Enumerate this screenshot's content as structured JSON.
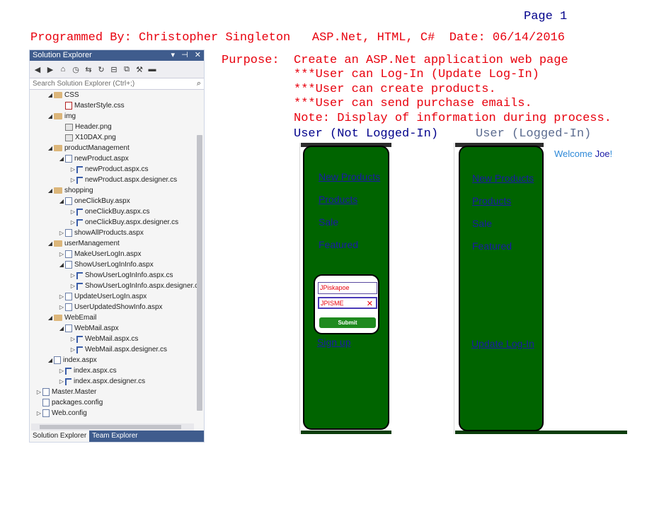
{
  "header": {
    "page_label": "Page 1",
    "programmed_line": "Programmed By: Christopher Singleton   ASP.Net, HTML, C#  Date: 06/14/2016"
  },
  "purpose": {
    "label": "Purpose:",
    "lines": [
      "Create an ASP.Net application web page",
      "***User can Log-In (Update Log-In)",
      "***User can create products.",
      "***User can send purchase emails.",
      "Note: Display of information during process."
    ],
    "user_not_logged": "User (Not Logged-In)",
    "user_logged": "User (Logged-In)"
  },
  "solution_explorer": {
    "title": "Solution Explorer",
    "title_buttons": [
      "▾",
      "⊣",
      "✕"
    ],
    "search_placeholder": "Search Solution Explorer (Ctrl+;)",
    "tree": [
      {
        "label": "CSS",
        "indent": 0,
        "arrow": "◢",
        "icon": "folder"
      },
      {
        "label": "MasterStyle.css",
        "indent": 1,
        "arrow": "",
        "icon": "css"
      },
      {
        "label": "img",
        "indent": 0,
        "arrow": "◢",
        "icon": "folder"
      },
      {
        "label": "Header.png",
        "indent": 1,
        "arrow": "",
        "icon": "img"
      },
      {
        "label": "X10DAX.png",
        "indent": 1,
        "arrow": "",
        "icon": "img"
      },
      {
        "label": "productManagement",
        "indent": 0,
        "arrow": "◢",
        "icon": "folder"
      },
      {
        "label": "newProduct.aspx",
        "indent": 1,
        "arrow": "◢",
        "icon": "page"
      },
      {
        "label": "newProduct.aspx.cs",
        "indent": 2,
        "arrow": "▷",
        "icon": "cs"
      },
      {
        "label": "newProduct.aspx.designer.cs",
        "indent": 2,
        "arrow": "▷",
        "icon": "cs"
      },
      {
        "label": "shopping",
        "indent": 0,
        "arrow": "◢",
        "icon": "folder"
      },
      {
        "label": "oneClickBuy.aspx",
        "indent": 1,
        "arrow": "◢",
        "icon": "page"
      },
      {
        "label": "oneClickBuy.aspx.cs",
        "indent": 2,
        "arrow": "▷",
        "icon": "cs"
      },
      {
        "label": "oneClickBuy.aspx.designer.cs",
        "indent": 2,
        "arrow": "▷",
        "icon": "cs"
      },
      {
        "label": "showAllProducts.aspx",
        "indent": 1,
        "arrow": "▷",
        "icon": "page"
      },
      {
        "label": "userManagement",
        "indent": 0,
        "arrow": "◢",
        "icon": "folder"
      },
      {
        "label": "MakeUserLogIn.aspx",
        "indent": 1,
        "arrow": "▷",
        "icon": "page"
      },
      {
        "label": "ShowUserLogInInfo.aspx",
        "indent": 1,
        "arrow": "◢",
        "icon": "page"
      },
      {
        "label": "ShowUserLogInInfo.aspx.cs",
        "indent": 2,
        "arrow": "▷",
        "icon": "cs"
      },
      {
        "label": "ShowUserLogInInfo.aspx.designer.c",
        "indent": 2,
        "arrow": "▷",
        "icon": "cs"
      },
      {
        "label": "UpdateUserLogIn.aspx",
        "indent": 1,
        "arrow": "▷",
        "icon": "page"
      },
      {
        "label": "UserUpdatedShowInfo.aspx",
        "indent": 1,
        "arrow": "▷",
        "icon": "page"
      },
      {
        "label": "WebEmail",
        "indent": 0,
        "arrow": "◢",
        "icon": "folder"
      },
      {
        "label": "WebMail.aspx",
        "indent": 1,
        "arrow": "◢",
        "icon": "page"
      },
      {
        "label": "WebMail.aspx.cs",
        "indent": 2,
        "arrow": "▷",
        "icon": "cs"
      },
      {
        "label": "WebMail.aspx.designer.cs",
        "indent": 2,
        "arrow": "▷",
        "icon": "cs"
      },
      {
        "label": "index.aspx",
        "indent": 0,
        "arrow": "◢",
        "icon": "page"
      },
      {
        "label": "index.aspx.cs",
        "indent": 1,
        "arrow": "▷",
        "icon": "cs"
      },
      {
        "label": "index.aspx.designer.cs",
        "indent": 1,
        "arrow": "▷",
        "icon": "cs"
      },
      {
        "label": "Master.Master",
        "indent": -1,
        "arrow": "▷",
        "icon": "page"
      },
      {
        "label": "packages.config",
        "indent": -1,
        "arrow": "",
        "icon": "config"
      },
      {
        "label": "Web.config",
        "indent": -1,
        "arrow": "▷",
        "icon": "config"
      }
    ],
    "tabs": [
      "Solution Explorer",
      "Team Explorer"
    ]
  },
  "left_panel": {
    "links": [
      "New Products",
      "Products"
    ],
    "plain": [
      "Sale",
      "Featured"
    ],
    "login": {
      "username_value": "JPiskapoe",
      "password_value": "JPISME",
      "submit_label": "Submit"
    },
    "signup_label": "Sign up"
  },
  "right_panel": {
    "welcome_prefix": "Welcome ",
    "welcome_name": "Joe",
    "welcome_suffix": "!",
    "links": [
      "New Products",
      "Products"
    ],
    "plain": [
      "Sale",
      "Featured"
    ],
    "update_label": "Update Log-In"
  },
  "colors": {
    "red_text": "#e8000d",
    "navy_text": "#00008b",
    "nav_green": "#006400",
    "link_blue": "#1a1aa6"
  }
}
